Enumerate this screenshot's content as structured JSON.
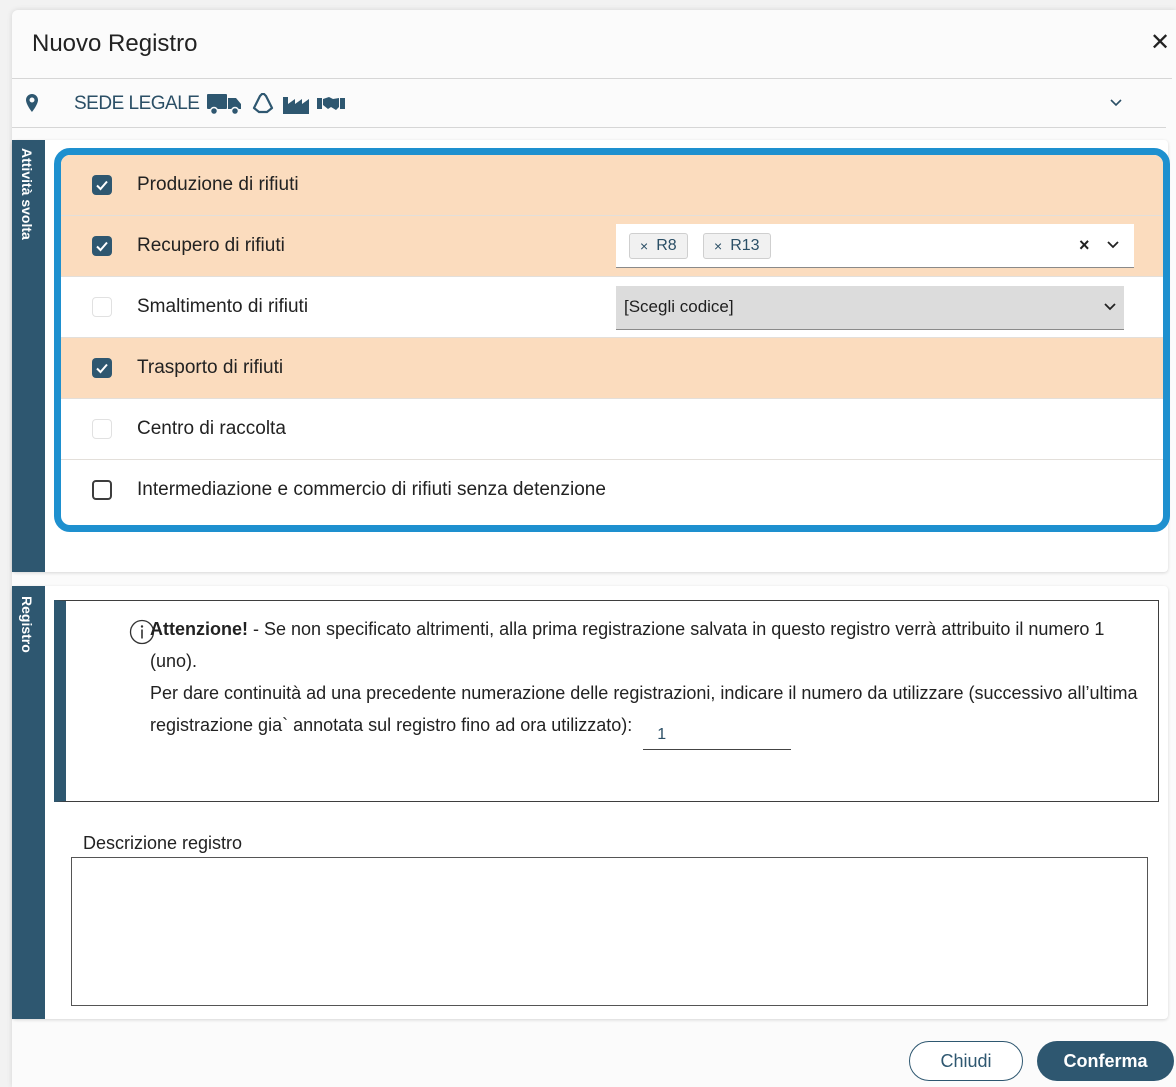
{
  "dialog": {
    "title": "Nuovo Registro",
    "close_icon": "close-icon"
  },
  "sede": {
    "label": "SEDE LEGALE",
    "icons": [
      "map-pin-icon",
      "truck-icon",
      "recycle-icon",
      "factory-icon",
      "handshake-icon"
    ],
    "expand_icon": "chevron-down-icon"
  },
  "activity_section": {
    "tab_label": "Attività svolta",
    "rows": [
      {
        "label": "Produzione di rifiuti",
        "checked": true
      },
      {
        "label": "Recupero di rifiuti",
        "checked": true,
        "codes": [
          "R8",
          "R13"
        ]
      },
      {
        "label": "Smaltimento di rifiuti",
        "checked": false,
        "select_value": "[Scegli codice]"
      },
      {
        "label": "Trasporto di rifiuti",
        "checked": true
      },
      {
        "label": "Centro di raccolta",
        "checked": false
      },
      {
        "label": "Intermediazione e commercio di rifiuti senza detenzione",
        "checked": false
      }
    ],
    "highlight_color": "#fbdcbe",
    "focus_border_color": "#1e90cf"
  },
  "registro_section": {
    "tab_label": "Registro",
    "notice": {
      "bold": "Attenzione!",
      "line1": " - Se non specificato altrimenti, alla prima registrazione salvata in questo registro verrà attribuito il numero 1 (uno).",
      "line2": "Per dare continuità ad una precedente numerazione delle registrazioni, indicare il numero da utilizzare (successivo all’ultima registrazione gia` annotata sul registro fino ad ora utilizzato):",
      "number_value": "1"
    },
    "description_label": "Descrizione registro",
    "description_value": ""
  },
  "footer": {
    "close_label": "Chiudi",
    "confirm_label": "Conferma"
  },
  "colors": {
    "brand": "#2e5770",
    "text": "#222222"
  }
}
